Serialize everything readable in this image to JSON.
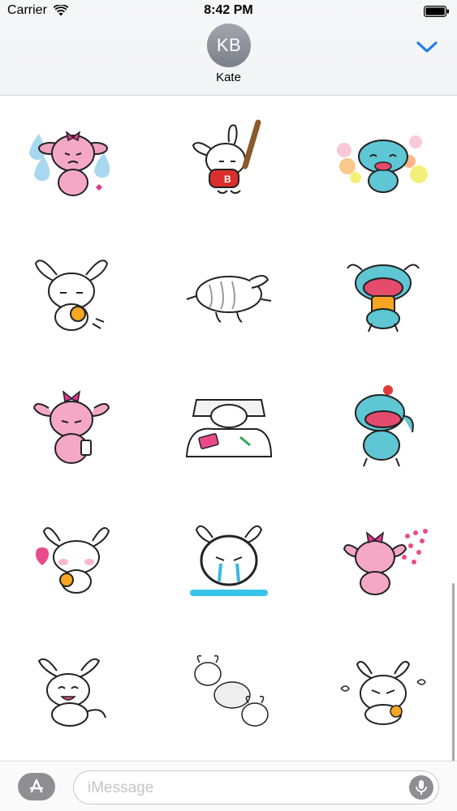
{
  "status_bar": {
    "carrier": "Carrier",
    "time": "8:42 PM",
    "wifi_icon": "wifi-icon",
    "battery_icon": "battery-icon"
  },
  "conversation": {
    "avatar_initials": "KB",
    "contact_name": "Kate",
    "collapse_icon": "chevron-down-icon",
    "accent_color": "#1a7ee8"
  },
  "sticker_grid": {
    "columns": 3,
    "stickers": [
      {
        "id": 1,
        "icon": "pink-girl-crying-sticker"
      },
      {
        "id": 2,
        "icon": "white-bunny-baseball-sticker"
      },
      {
        "id": 3,
        "icon": "blue-creature-bubbles-sticker"
      },
      {
        "id": 4,
        "icon": "white-bunny-honey-sticker"
      },
      {
        "id": 5,
        "icon": "white-bunny-sleeping-sticker"
      },
      {
        "id": 6,
        "icon": "blue-creature-eating-sticker"
      },
      {
        "id": 7,
        "icon": "pink-girl-drink-sticker"
      },
      {
        "id": 8,
        "icon": "white-bunny-in-bed-sticker"
      },
      {
        "id": 9,
        "icon": "blue-creature-cherry-sticker"
      },
      {
        "id": 10,
        "icon": "white-bunny-heart-sticker"
      },
      {
        "id": 11,
        "icon": "white-bunny-tears-sticker"
      },
      {
        "id": 12,
        "icon": "pink-girl-hearts-sticker"
      },
      {
        "id": 13,
        "icon": "white-bunny-laughing-sticker"
      },
      {
        "id": 14,
        "icon": "white-bunny-tumbling-sticker"
      },
      {
        "id": 15,
        "icon": "white-bunny-angry-sticker"
      }
    ]
  },
  "input_bar": {
    "appstore_icon": "app-store-icon",
    "placeholder": "iMessage",
    "mic_icon": "microphone-icon"
  }
}
